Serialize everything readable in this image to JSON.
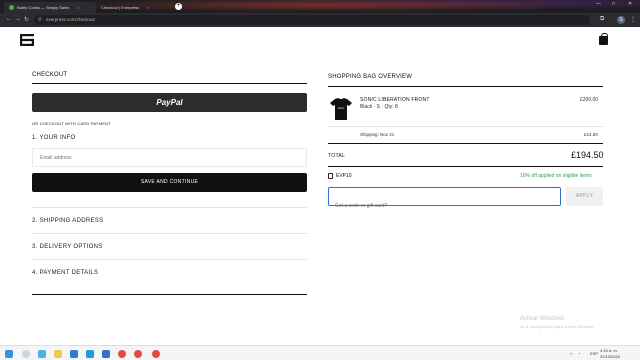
{
  "browser": {
    "tabs": [
      {
        "title": "Notify Codes — Simply Sales",
        "active": true
      },
      {
        "title": "Checkout | Everpress",
        "active": false
      }
    ],
    "url": "everpress.com/checkout"
  },
  "checkout": {
    "heading": "CHECKOUT",
    "paypal_label": "PayPal",
    "card_label": "OR CHECKOUT WITH CARD PAYMENT",
    "your_info": "1. YOUR INFO",
    "email_placeholder": "Email address",
    "save_button": "SAVE AND CONTINUE",
    "shipping": "2. SHIPPING ADDRESS",
    "delivery": "3. DELIVERY OPTIONS",
    "payment": "4. PAYMENT DETAILS"
  },
  "bag": {
    "heading": "SHOPPING BAG OVERVIEW",
    "product_name": "SONIC LIBERATION FRONT",
    "product_meta": "Black · S · Qty: 8",
    "product_price": "£200.00",
    "shipping_label": "Shipping: Nov 21",
    "shipping_price": "£14.50",
    "total_label": "TOTAL",
    "total_value": "£194.50",
    "code": "EVP10",
    "promo_note": "10% off applied on eligible items",
    "gift_placeholder": "Got a code or gift card?",
    "apply_button": "APPLY"
  },
  "watermark": {
    "title": "Activar Windows",
    "subtitle": "Ve a Configuración para activar Windows."
  },
  "taskbar": {
    "lang": "ESP",
    "time": "4:15 a. m.",
    "date": "22/10/2024"
  },
  "colors": {
    "accent_blue": "#2f6fd6",
    "promo_green": "#2aa14a",
    "button_dark": "#111111"
  }
}
